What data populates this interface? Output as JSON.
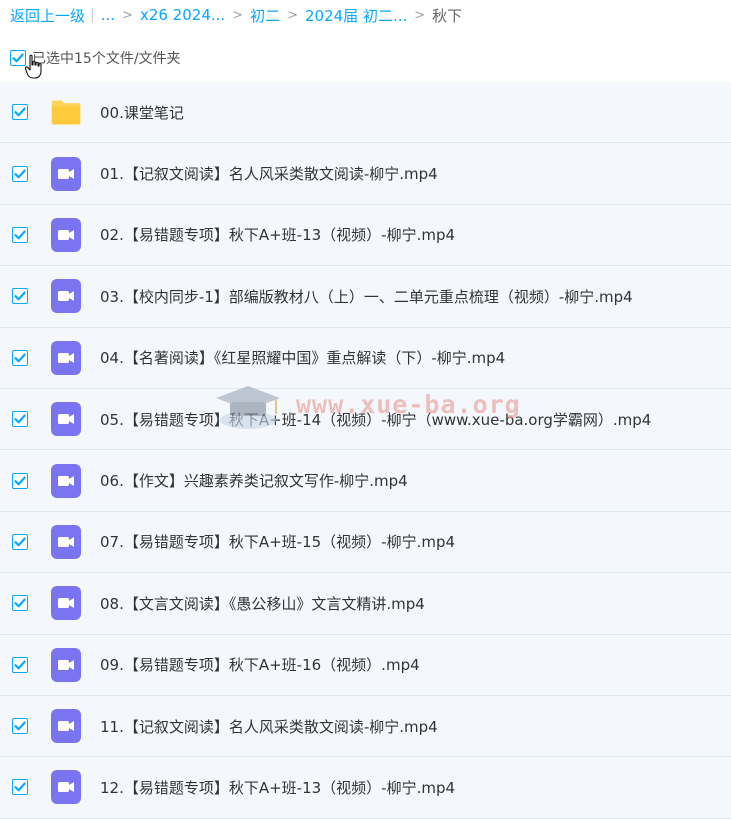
{
  "breadcrumb": {
    "back": "返回上一级",
    "ellipsis": "...",
    "items": [
      "x26 2024...",
      "初二",
      "2024届 初二...",
      "秋下"
    ]
  },
  "selection": {
    "label": "已选中15个文件/文件夹"
  },
  "colors": {
    "accent": "#06a7ff",
    "row_bg": "#f4f8fd",
    "folder": "#ffd25a",
    "video_icon": "#7b74f0"
  },
  "files": [
    {
      "name": "00.课堂笔记",
      "icon": "folder-icon"
    },
    {
      "name": "01.【记叙文阅读】名人风采类散文阅读-柳宁.mp4",
      "icon": "video-file-icon"
    },
    {
      "name": "02.【易错题专项】秋下A+班-13（视频）-柳宁.mp4",
      "icon": "video-file-icon"
    },
    {
      "name": "03.【校内同步-1】部编版教材八（上）一、二单元重点梳理（视频）-柳宁.mp4",
      "icon": "video-file-icon"
    },
    {
      "name": "04.【名著阅读】《红星照耀中国》重点解读（下）-柳宁.mp4",
      "icon": "video-file-icon"
    },
    {
      "name": "05.【易错题专项】秋下A+班-14（视频）-柳宁（www.xue-ba.org学霸网）.mp4",
      "icon": "video-file-icon"
    },
    {
      "name": "06.【作文】兴趣素养类记叙文写作-柳宁.mp4",
      "icon": "video-file-icon"
    },
    {
      "name": "07.【易错题专项】秋下A+班-15（视频）-柳宁.mp4",
      "icon": "video-file-icon"
    },
    {
      "name": "08.【文言文阅读】《愚公移山》文言文精讲.mp4",
      "icon": "video-file-icon"
    },
    {
      "name": "09.【易错题专项】秋下A+班-16（视频）.mp4",
      "icon": "video-file-icon"
    },
    {
      "name": "11.【记叙文阅读】名人风采类散文阅读-柳宁.mp4",
      "icon": "video-file-icon"
    },
    {
      "name": "12.【易错题专项】秋下A+班-13（视频）-柳宁.mp4",
      "icon": "video-file-icon"
    }
  ],
  "watermark": {
    "text": "www.xue-ba.org"
  }
}
